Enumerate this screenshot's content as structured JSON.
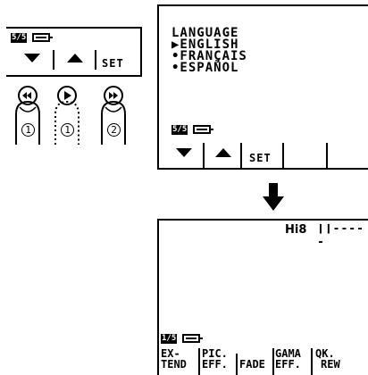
{
  "mini_panel": {
    "badge": "5/5",
    "set_label": "SET"
  },
  "fingers": [
    {
      "button": "rewind",
      "number": "1"
    },
    {
      "button": "play",
      "number": "1"
    },
    {
      "button": "fast-forward",
      "number": "2"
    }
  ],
  "language_screen": {
    "title": "LANGUAGE",
    "options": [
      "▶ENGLISH",
      "•FRANÇAIS",
      "•ESPAÑOL"
    ],
    "badge": "5/5",
    "set_label": "SET"
  },
  "effect_screen": {
    "indicator": "Hi8",
    "tape_indicator": "❙❙-----",
    "badge": "1/5",
    "buttons": [
      {
        "line1": "EX-",
        "line2": "TEND"
      },
      {
        "line1": "PIC.",
        "line2": "EFF."
      },
      {
        "line1": "",
        "line2": "FADE"
      },
      {
        "line1": "GAMA",
        "line2": "EFF."
      },
      {
        "line1": "QK.",
        "line2": "REW"
      }
    ]
  }
}
